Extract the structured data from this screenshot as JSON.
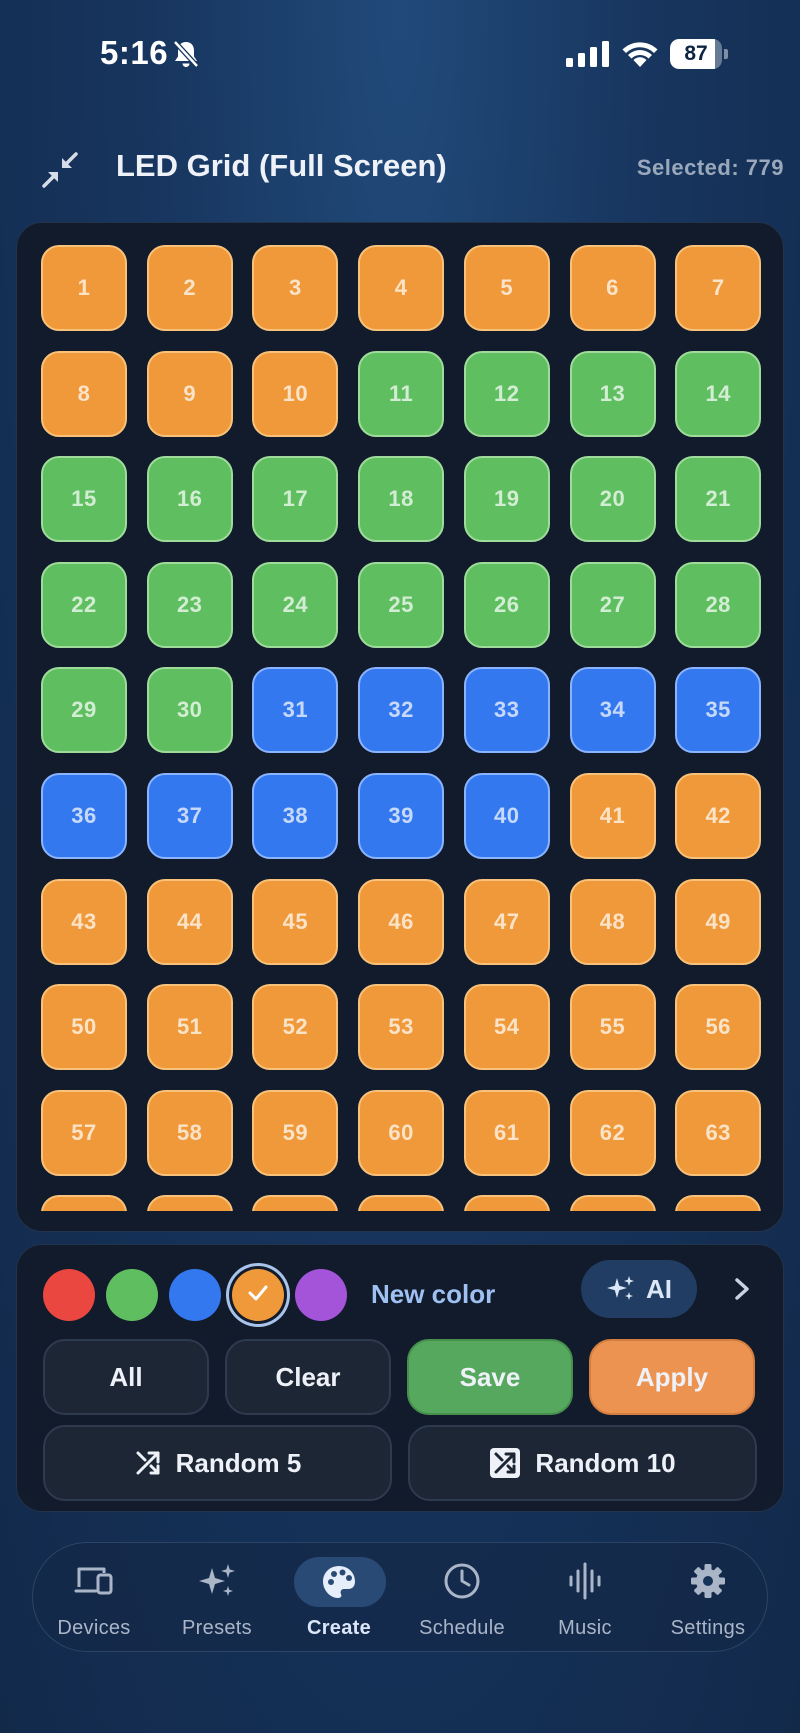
{
  "status": {
    "time": "5:16",
    "battery": "87",
    "battery_level": 0.87
  },
  "header": {
    "title": "LED Grid (Full Screen)",
    "selected": "Selected: 779"
  },
  "grid": {
    "columns": 7,
    "leds": [
      {
        "label": "1",
        "color": "orange"
      },
      {
        "label": "2",
        "color": "orange"
      },
      {
        "label": "3",
        "color": "orange"
      },
      {
        "label": "4",
        "color": "orange"
      },
      {
        "label": "5",
        "color": "orange"
      },
      {
        "label": "6",
        "color": "orange"
      },
      {
        "label": "7",
        "color": "orange"
      },
      {
        "label": "8",
        "color": "orange"
      },
      {
        "label": "9",
        "color": "orange"
      },
      {
        "label": "10",
        "color": "orange"
      },
      {
        "label": "11",
        "color": "green"
      },
      {
        "label": "12",
        "color": "green"
      },
      {
        "label": "13",
        "color": "green"
      },
      {
        "label": "14",
        "color": "green"
      },
      {
        "label": "15",
        "color": "green"
      },
      {
        "label": "16",
        "color": "green"
      },
      {
        "label": "17",
        "color": "green"
      },
      {
        "label": "18",
        "color": "green"
      },
      {
        "label": "19",
        "color": "green"
      },
      {
        "label": "20",
        "color": "green"
      },
      {
        "label": "21",
        "color": "green"
      },
      {
        "label": "22",
        "color": "green"
      },
      {
        "label": "23",
        "color": "green"
      },
      {
        "label": "24",
        "color": "green"
      },
      {
        "label": "25",
        "color": "green"
      },
      {
        "label": "26",
        "color": "green"
      },
      {
        "label": "27",
        "color": "green"
      },
      {
        "label": "28",
        "color": "green"
      },
      {
        "label": "29",
        "color": "green"
      },
      {
        "label": "30",
        "color": "green"
      },
      {
        "label": "31",
        "color": "blue"
      },
      {
        "label": "32",
        "color": "blue"
      },
      {
        "label": "33",
        "color": "blue"
      },
      {
        "label": "34",
        "color": "blue"
      },
      {
        "label": "35",
        "color": "blue"
      },
      {
        "label": "36",
        "color": "blue"
      },
      {
        "label": "37",
        "color": "blue"
      },
      {
        "label": "38",
        "color": "blue"
      },
      {
        "label": "39",
        "color": "blue"
      },
      {
        "label": "40",
        "color": "blue"
      },
      {
        "label": "41",
        "color": "orange"
      },
      {
        "label": "42",
        "color": "orange"
      },
      {
        "label": "43",
        "color": "orange"
      },
      {
        "label": "44",
        "color": "orange"
      },
      {
        "label": "45",
        "color": "orange"
      },
      {
        "label": "46",
        "color": "orange"
      },
      {
        "label": "47",
        "color": "orange"
      },
      {
        "label": "48",
        "color": "orange"
      },
      {
        "label": "49",
        "color": "orange"
      },
      {
        "label": "50",
        "color": "orange"
      },
      {
        "label": "51",
        "color": "orange"
      },
      {
        "label": "52",
        "color": "orange"
      },
      {
        "label": "53",
        "color": "orange"
      },
      {
        "label": "54",
        "color": "orange"
      },
      {
        "label": "55",
        "color": "orange"
      },
      {
        "label": "56",
        "color": "orange"
      },
      {
        "label": "57",
        "color": "orange"
      },
      {
        "label": "58",
        "color": "orange"
      },
      {
        "label": "59",
        "color": "orange"
      },
      {
        "label": "60",
        "color": "orange"
      },
      {
        "label": "61",
        "color": "orange"
      },
      {
        "label": "62",
        "color": "orange"
      },
      {
        "label": "63",
        "color": "orange"
      }
    ],
    "colors": {
      "orange": "#f0993a",
      "green": "#5fbf60",
      "blue": "#3478f0"
    }
  },
  "palette": {
    "swatches": [
      {
        "name": "red",
        "color": "#e9473f",
        "selected": false
      },
      {
        "name": "green",
        "color": "#5fbf60",
        "selected": false
      },
      {
        "name": "blue",
        "color": "#3478f0",
        "selected": false
      },
      {
        "name": "orange",
        "color": "#f0993a",
        "selected": true
      },
      {
        "name": "purple",
        "color": "#a354d8",
        "selected": false
      }
    ],
    "new_color": "New color",
    "ai_label": "AI"
  },
  "actions": {
    "all": "All",
    "clear": "Clear",
    "save": "Save",
    "apply": "Apply",
    "random5": "Random 5",
    "random10": "Random 10"
  },
  "nav": {
    "items": [
      {
        "label": "Devices",
        "icon": "devices-icon"
      },
      {
        "label": "Presets",
        "icon": "sparkles-icon"
      },
      {
        "label": "Create",
        "icon": "palette-icon",
        "active": true
      },
      {
        "label": "Schedule",
        "icon": "clock-icon"
      },
      {
        "label": "Music",
        "icon": "waveform-icon"
      },
      {
        "label": "Settings",
        "icon": "gear-icon"
      }
    ]
  }
}
